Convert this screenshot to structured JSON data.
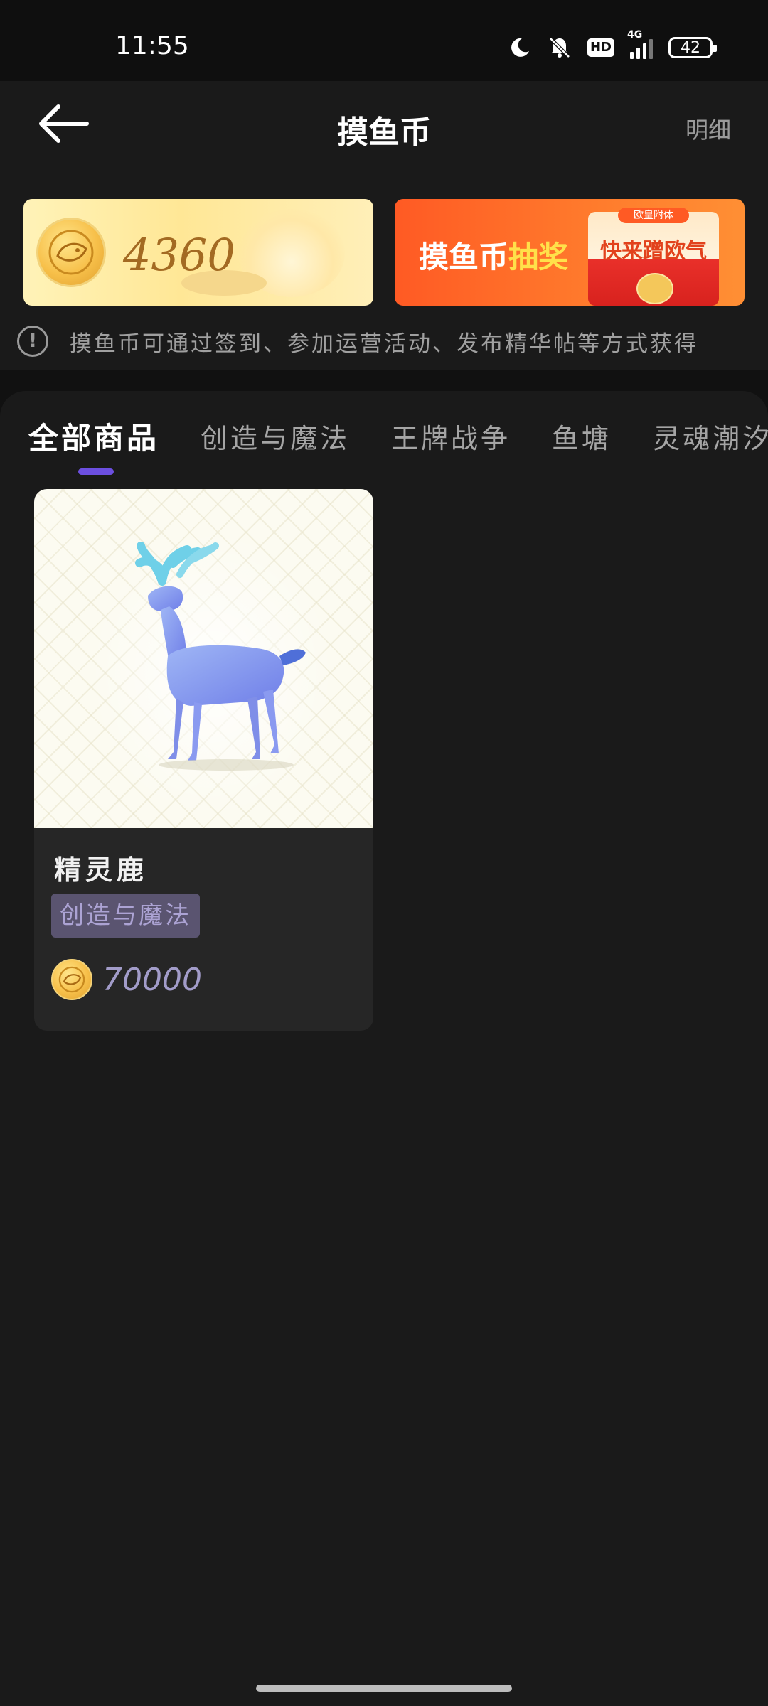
{
  "status_bar": {
    "time": "11:55",
    "hd": "HD",
    "network": "4G",
    "battery": "42",
    "icons": [
      "moon-icon",
      "bell-muted-icon",
      "hd-icon",
      "signal-icon",
      "battery-icon"
    ]
  },
  "header": {
    "back_icon": "arrow-left-icon",
    "title": "摸鱼币",
    "detail_link": "明细"
  },
  "balance_banner": {
    "coin_icon": "fish-coin-icon",
    "amount": "4360"
  },
  "lottery_banner": {
    "title_part1": "摸鱼币",
    "title_part2": "抽奖",
    "envelope_text": "快来蹭欧气",
    "envelope_tag": "欧皇附体"
  },
  "info": {
    "icon": "info-icon",
    "text": "摸鱼币可通过签到、参加运营活动、发布精华帖等方式获得"
  },
  "tabs": [
    {
      "label": "全部商品",
      "active": true
    },
    {
      "label": "创造与魔法",
      "active": false
    },
    {
      "label": "王牌战争",
      "active": false
    },
    {
      "label": "鱼塘",
      "active": false
    },
    {
      "label": "灵魂潮汐",
      "active": false
    }
  ],
  "products": [
    {
      "name": "精灵鹿",
      "tag": "创造与魔法",
      "price": "70000",
      "image": "spirit-deer-image"
    }
  ],
  "colors": {
    "background": "#1a1a1a",
    "accent": "#6c4fe0",
    "tag_bg": "#5a5470",
    "tag_text": "#aca3d4",
    "price_text": "#a29cc9",
    "lottery_orange": "#ff6a2a",
    "balance_text": "#a36a22"
  }
}
